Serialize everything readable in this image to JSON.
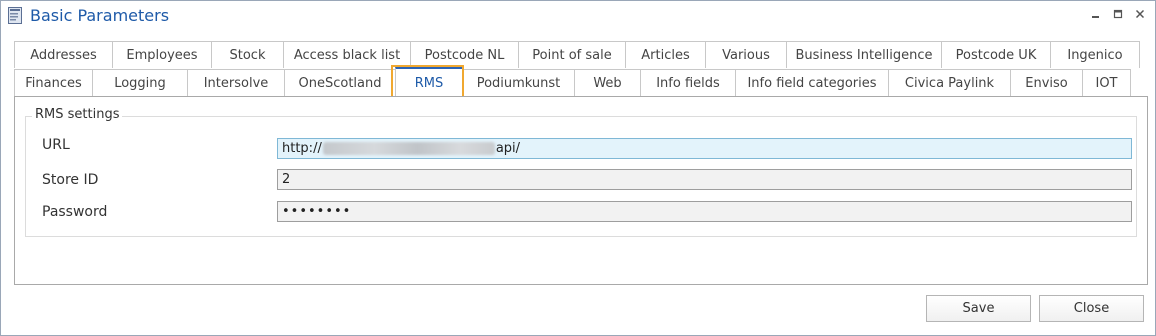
{
  "window": {
    "title": "Basic Parameters",
    "icon": "document-icon"
  },
  "tabs": {
    "row1": [
      "Addresses",
      "Employees",
      "Stock",
      "Access black list",
      "Postcode NL",
      "Point of sale",
      "Articles",
      "Various",
      "Business Intelligence",
      "Postcode UK",
      "Ingenico"
    ],
    "row2": [
      "Finances",
      "Logging",
      "Intersolve",
      "OneScotland",
      "RMS",
      "Podiumkunst",
      "Web",
      "Info fields",
      "Info field categories",
      "Civica Paylink",
      "Enviso",
      "IOT"
    ],
    "active": "RMS"
  },
  "rms_settings": {
    "group_title": "RMS settings",
    "url_label": "URL",
    "url_prefix": "http://",
    "url_suffix": "api/",
    "store_id_label": "Store ID",
    "store_id_value": "2",
    "password_label": "Password",
    "password_value": "••••••••"
  },
  "footer": {
    "save_label": "Save",
    "close_label": "Close"
  },
  "colors": {
    "title": "#1e5aa8",
    "active_tab_highlight": "#f0a830",
    "focused_field": "#e3f3fb"
  }
}
